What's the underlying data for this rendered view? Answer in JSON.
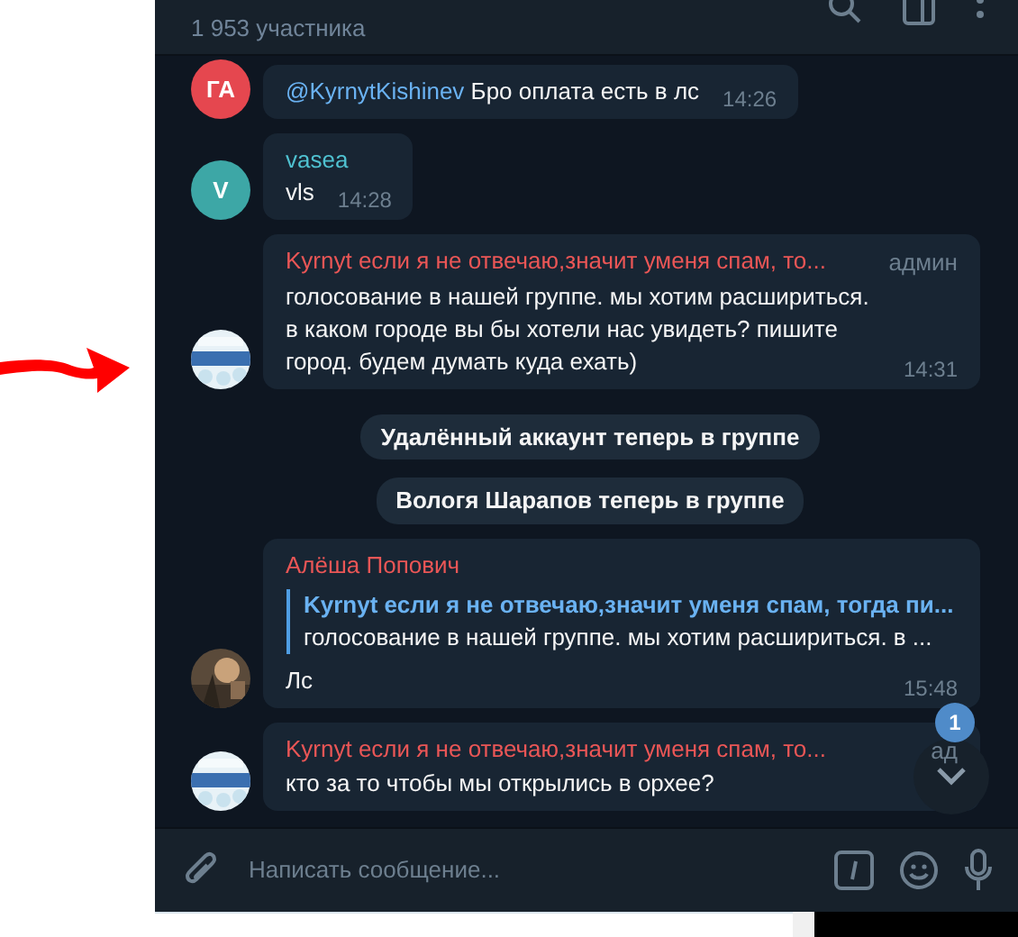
{
  "header": {
    "subtitle": "1 953 участника"
  },
  "messages": [
    {
      "kind": "message",
      "avatar": {
        "kind": "initials",
        "initials": "ГА",
        "color": "#e5474f"
      },
      "mention": "@KyrnytKishinev",
      "text": "Бро оплата есть в лс",
      "time": "14:26"
    },
    {
      "kind": "message",
      "avatar": {
        "kind": "initials",
        "initials": "V",
        "color": "#3da7a6"
      },
      "sender": "vasea",
      "color": "#4fc1d0",
      "text": "vls",
      "time": "14:28"
    },
    {
      "kind": "message",
      "sender": "Kyrnyt если я не отвечаю,значит уменя спам, то...",
      "color": "#ea5656",
      "admin": "админ",
      "text": "голосование в нашей группе. мы хотим расшириться. в каком городе вы бы хотели нас увидеть? пишите город. будем думать куда ехать)",
      "time": "14:31"
    },
    {
      "kind": "service",
      "text": "Удалённый аккаунт теперь в группе"
    },
    {
      "kind": "service",
      "text": "Вологя Шарапов теперь в группе"
    },
    {
      "kind": "message",
      "sender": "Алёша Попович",
      "color": "#ea5656",
      "reply": {
        "author": "Kyrnyt если я не отвечаю,значит уменя спам, тогда пи...",
        "text": "голосование в нашей группе. мы хотим расшириться. в ..."
      },
      "text": "Лс",
      "time": "15:48"
    },
    {
      "kind": "message",
      "sender": "Kyrnyt если я не отвечаю,значит уменя спам, то...",
      "color": "#ea5656",
      "admin": "ад",
      "text": "кто за то чтобы мы открылись в орхее?"
    }
  ],
  "scroll_button": {
    "badge": "1"
  },
  "composer": {
    "placeholder": "Написать сообщение..."
  }
}
